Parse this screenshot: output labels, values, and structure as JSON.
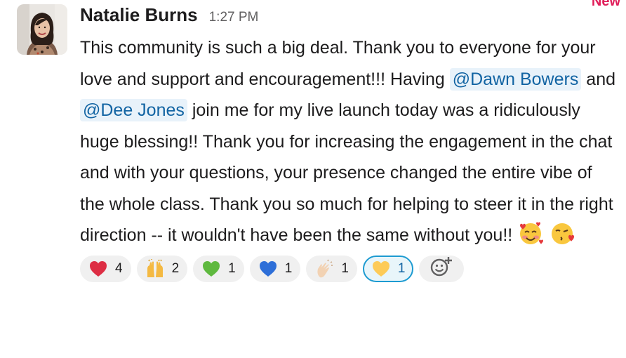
{
  "new_marker": "New",
  "message": {
    "sender": "Natalie Burns",
    "timestamp": "1:27 PM",
    "text_part1": "This community is such a big deal. Thank you to everyone for your love and support and encouragement!!! Having ",
    "mention1": "@Dawn Bowers",
    "text_and": " and ",
    "mention2": "@Dee Jones",
    "text_part2": " join me for my live launch today was a ridiculously huge blessing!! Thank you for increasing the engagement in the chat and with your questions, your presence changed the entire vibe of the whole class. Thank you so much for helping to steer it in the right direction -- it wouldn't have been the same without you!! ",
    "inline_emojis": [
      "smiling-face-with-hearts",
      "face-blowing-a-kiss"
    ]
  },
  "reactions": [
    {
      "emoji": "red-heart",
      "count": "4",
      "active": false
    },
    {
      "emoji": "raising-hands",
      "count": "2",
      "active": false
    },
    {
      "emoji": "green-heart",
      "count": "1",
      "active": false
    },
    {
      "emoji": "blue-heart",
      "count": "1",
      "active": false
    },
    {
      "emoji": "clapping-hands",
      "count": "1",
      "active": false
    },
    {
      "emoji": "yellow-heart",
      "count": "1",
      "active": true
    }
  ],
  "add_reaction_icon": "add-reaction-icon",
  "colors": {
    "mention_text": "#1264a3",
    "mention_bg": "#e8f2fa",
    "active_reaction_border": "#1d9bd1",
    "new_marker": "#e01e5a"
  }
}
